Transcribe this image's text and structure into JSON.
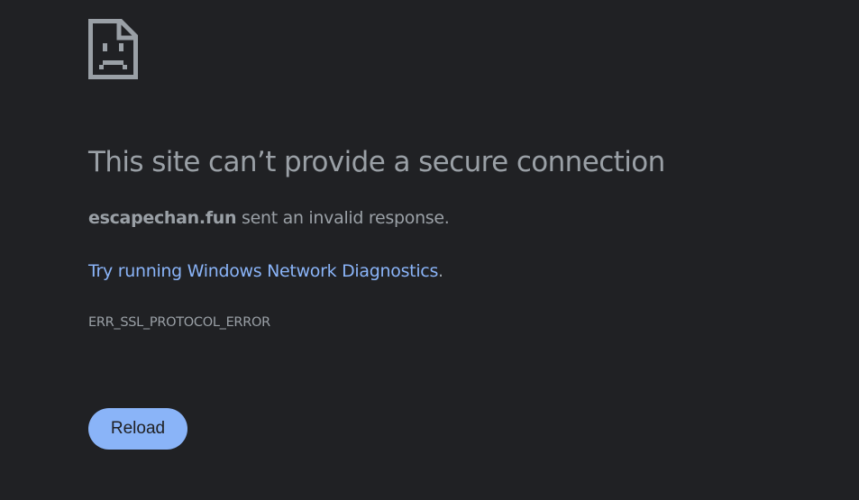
{
  "page": {
    "icon": "sad-page-icon",
    "title": "This site can’t provide a secure connection",
    "host": "escapechan.fun",
    "description_rest": " sent an invalid response.",
    "suggestion_link": "Try running Windows Network Diagnostics",
    "suggestion_period": ".",
    "error_code": "ERR_SSL_PROTOCOL_ERROR",
    "reload_label": "Reload"
  },
  "colors": {
    "background": "#202124",
    "text": "#9aa0a6",
    "link": "#8ab4f8",
    "button_bg": "#8ab4f8",
    "button_text": "#202124"
  }
}
